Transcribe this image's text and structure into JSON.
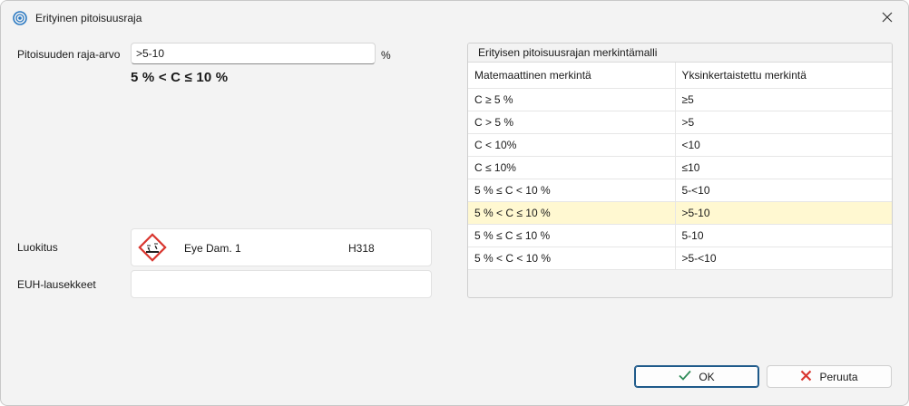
{
  "window": {
    "title": "Erityinen pitoisuusraja",
    "icon": "target-icon",
    "close_icon": "close-icon"
  },
  "form": {
    "limit_label": "Pitoisuuden raja-arvo",
    "limit_value": ">5-10",
    "limit_unit": "%",
    "formula": "5 % < C ≤ 10 %",
    "classification_label": "Luokitus",
    "classification": {
      "pictogram": "corrosive-hazard-icon",
      "hazard_class": "Eye Dam. 1",
      "hazard_code": "H318"
    },
    "euh_label": "EUH-lausekkeet",
    "euh_value": ""
  },
  "notation_table": {
    "caption": "Erityisen pitoisuusrajan merkintämalli",
    "headers": [
      "Matemaattinen merkintä",
      "Yksinkertaistettu merkintä"
    ],
    "rows": [
      [
        "C ≥ 5 %",
        "≥5"
      ],
      [
        "C > 5 %",
        ">5"
      ],
      [
        "C < 10%",
        "<10"
      ],
      [
        "C ≤ 10%",
        "≤10"
      ],
      [
        "5 % ≤ C < 10 %",
        "5-<10"
      ],
      [
        "5 % < C ≤ 10 %",
        ">5-10"
      ],
      [
        "5 % ≤ C ≤ 10 %",
        "5-10"
      ],
      [
        "5 % < C < 10 %",
        ">5-<10"
      ]
    ],
    "selected_row": 5,
    "highlight_color": "#fff8d1"
  },
  "buttons": {
    "ok_label": "OK",
    "cancel_label": "Peruuta",
    "ok_icon_color": "#2e8b57",
    "cancel_icon_color": "#d9362f"
  }
}
